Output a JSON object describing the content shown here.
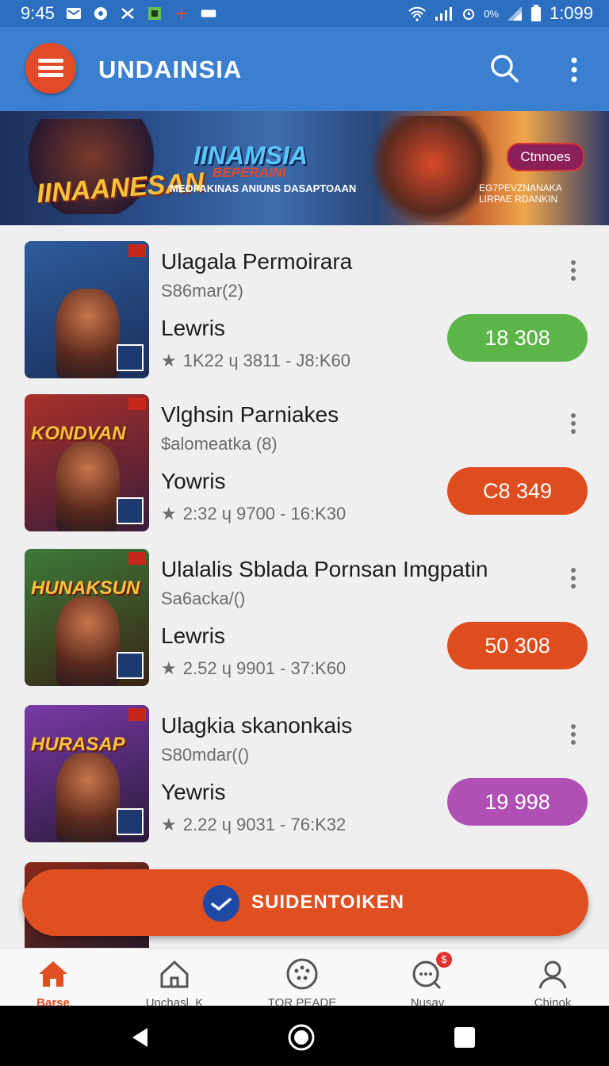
{
  "status_bar": {
    "time": "9:45",
    "right_text": "0%",
    "clock": "1:099"
  },
  "app_bar": {
    "title": "UNDAINSIA"
  },
  "banner": {
    "left_title": "IINAANESAN",
    "center_title": "IINAMSIA",
    "center_subtitle": "BEPERAINI",
    "center_tagline": "MEOPAKINAS ANIUNS DASAPTOAAN",
    "button_label": "Ctnnoes",
    "right_text": "EG7PEVZNANAKA LIRPAE RDANKIN"
  },
  "cards": [
    {
      "title": "Ulagala Permoirara",
      "subtitle": "S86mar(2)",
      "label": "Lewris",
      "meta": "1K22 ɥ 3811 - J8:K60",
      "button": "18 308",
      "button_color": "#5bb548",
      "thumb_title": "",
      "thumb_colors": [
        "#2e5c9c",
        "#1b2e5a"
      ]
    },
    {
      "title": "Vlghsin Parniakes",
      "subtitle": "$alomeatka (8)",
      "label": "Yowris",
      "meta": "2:32 ɥ 9700 - 16:K30",
      "button": "C8 349",
      "button_color": "#df4d1f",
      "thumb_title": "KONDVAN",
      "thumb_colors": [
        "#a9302a",
        "#3a1c3a"
      ]
    },
    {
      "title": "Ulalalis Sblada Pornsan Imgpatin",
      "subtitle": "Sa6acka/()",
      "label": "Lewris",
      "meta": "2.52 ɥ 9901 - 37:K60",
      "button": "50 308",
      "button_color": "#df4d1f",
      "thumb_title": "HUNAKSUN",
      "thumb_colors": [
        "#3d7a3a",
        "#3a2414"
      ]
    },
    {
      "title": "Ulagkia skanonkais",
      "subtitle": "S80mdar(()",
      "label": "Yewris",
      "meta": "2.22 ɥ 9031 - 76:K32",
      "button": "19 998",
      "button_color": "#b04fb4",
      "thumb_title": "HURASAP",
      "thumb_colors": [
        "#7a3aa8",
        "#2a1a3a"
      ]
    }
  ],
  "fab": {
    "label": "SUIDENTOIKEN"
  },
  "bottom_nav": [
    {
      "label": "Barse",
      "icon": "home-filled-icon",
      "active": true
    },
    {
      "label": "Unchasl. K",
      "icon": "home-outline-icon",
      "active": false
    },
    {
      "label": "TOR PEADE",
      "icon": "gamepad-icon",
      "active": false
    },
    {
      "label": "Nusav",
      "icon": "chat-search-icon",
      "active": false,
      "badge": "$"
    },
    {
      "label": "Chinok",
      "icon": "profile-icon",
      "active": false
    }
  ]
}
